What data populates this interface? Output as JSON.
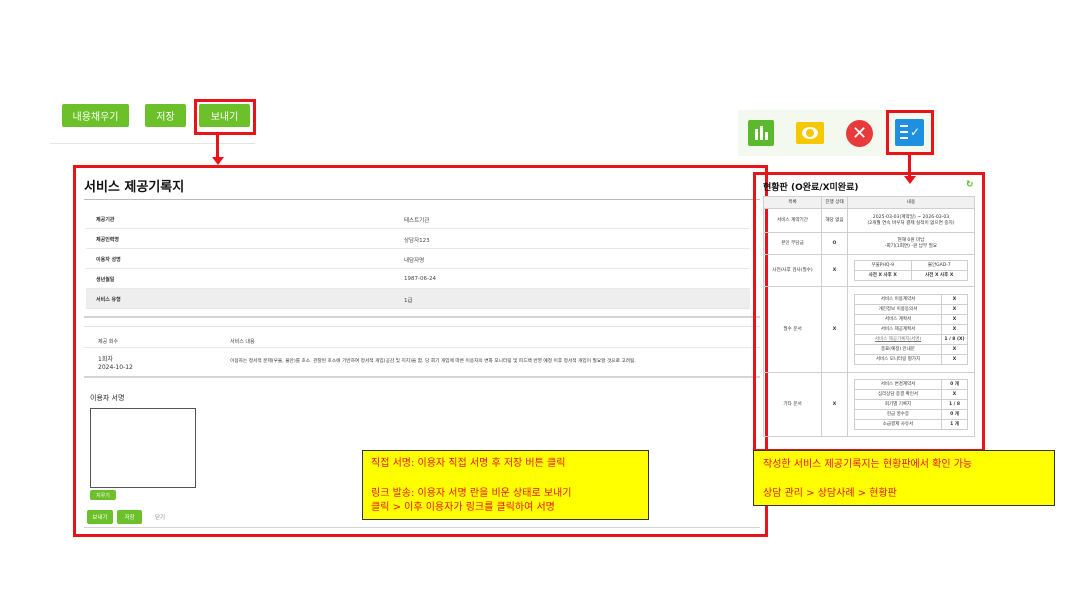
{
  "toolbar": {
    "fill_label": "내용채우기",
    "save_label": "저장",
    "send_label": "보내기"
  },
  "icons": [
    {
      "name": "bar-chart-icon",
      "color": "#5cb82c"
    },
    {
      "name": "eye-icon",
      "color": "#f5c800"
    },
    {
      "name": "close-circle-icon",
      "color": "#e83a3a"
    },
    {
      "name": "checklist-icon",
      "color": "#1f8fe0"
    }
  ],
  "record": {
    "title": "서비스 제공기록지",
    "fields": [
      {
        "label": "제공기관",
        "value": "테스트기관"
      },
      {
        "label": "제공인력명",
        "value": "상담자123"
      },
      {
        "label": "이용자 성명",
        "value": "내담자명"
      },
      {
        "label": "생년월일",
        "value": "1987-06-24"
      },
      {
        "label": "서비스 유형",
        "value": "1급"
      }
    ],
    "session_header": {
      "count_label": "제공 회수",
      "content_label": "서비스 내용"
    },
    "session": {
      "count": "1회차",
      "date": "2024-10-12",
      "content": "이용자는 정서적 문제(우울, 불안)를 호소. 관찰된 호소에 기반하여 정서적 개입(공감 및 지지)을 함. 당 회기 개입에 따른 이용자의 변화 모니터링 및 피드백 반영 예정 이후 정서적 개입이 필요할 것으로 고려됨."
    },
    "signature_label": "이용자 서명",
    "erase_label": "지우기",
    "footer": {
      "send_label": "보내기",
      "save_label": "저장",
      "close_label": "닫기"
    }
  },
  "status": {
    "title": "현황판 (O완료/X미완료)",
    "refresh_icon": "refresh-icon",
    "headers": [
      "목록",
      "진행 상태",
      "내용"
    ],
    "contract": {
      "label": "서비스 계약기간",
      "state": "해당 없음",
      "line1": "2025-03-03(계약일) ~ 2026-03-03",
      "line2": "(2개월 연속 바우처 결제 실적이 없으면 중지)"
    },
    "copay": {
      "label": "본인 부담금",
      "state": "O",
      "line1": "현재 0원 미납",
      "line2": "-회기(1회면) -원 납부 필요"
    },
    "tests": {
      "label": "사전/사후 검사(필수)",
      "state": "X",
      "phq_label": "우울PHQ-9",
      "gad_label": "불안GAD-7",
      "phq_status": "사전 X 사후 X",
      "gad_status": "사전 X 사후 X"
    },
    "required": {
      "label": "필수 문서",
      "state": "X",
      "items": [
        {
          "name": "서비스 이용계약서",
          "mark": "X"
        },
        {
          "name": "개인정보 이용동의서",
          "mark": "X"
        },
        {
          "name": "서비스 계획서",
          "mark": "X"
        },
        {
          "name": "서비스 제공계획서",
          "mark": "X"
        },
        {
          "name": "서비스 제공기록지(서명)",
          "mark": "1 / 8 (X)"
        },
        {
          "name": "종료(예정) 안내문",
          "mark": "X"
        },
        {
          "name": "서비스 모니터링 평가지",
          "mark": "X"
        }
      ]
    },
    "other": {
      "label": "기타 문서",
      "state": "X",
      "items": [
        {
          "name": "서비스 변경계약서",
          "mark": "0 개"
        },
        {
          "name": "심리상담 종결 확인서",
          "mark": "X"
        },
        {
          "name": "회기별 기록지",
          "mark": "1 / 8"
        },
        {
          "name": "현금 영수증",
          "mark": "0 개"
        },
        {
          "name": "소급결제 사유서",
          "mark": "1 개"
        }
      ]
    }
  },
  "callouts": {
    "left_line1": "직접 서명: 이용자 직접 서명 후 저장 버튼 클릭",
    "left_line2": "링크 발송: 이용자 서명 란을 비운 상태로 보내기",
    "left_line3": "클릭 > 이후 이용자가 링크를 클릭하여 서명",
    "right_line1": "작성한 서비스 제공기록지는 현황판에서 확인 가능",
    "right_line2": "상담 관리 > 상담사례 > 현황판"
  }
}
